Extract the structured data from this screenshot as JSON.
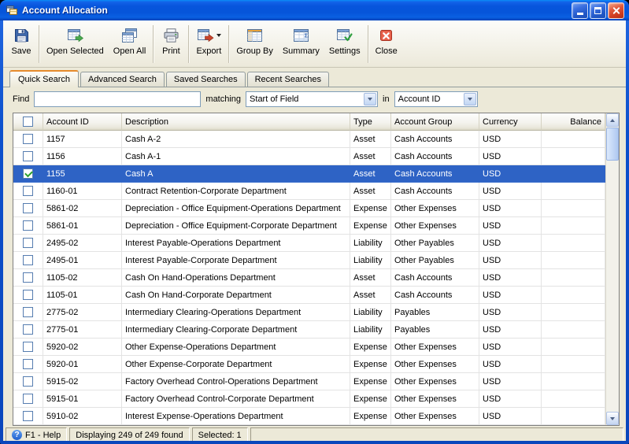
{
  "window": {
    "title": "Account Allocation"
  },
  "icons": {
    "help_glyph": "?"
  },
  "toolbar": {
    "buttons": [
      {
        "label": "Save",
        "icon": "save-icon"
      },
      {
        "label": "Open Selected",
        "icon": "open-selected-icon"
      },
      {
        "label": "Open All",
        "icon": "open-all-icon"
      },
      {
        "label": "Print",
        "icon": "print-icon"
      },
      {
        "label": "Export",
        "icon": "export-icon",
        "has_dropdown": true
      },
      {
        "label": "Group By",
        "icon": "group-by-icon"
      },
      {
        "label": "Summary",
        "icon": "summary-icon"
      },
      {
        "label": "Settings",
        "icon": "settings-icon"
      },
      {
        "label": "Close",
        "icon": "close-window-icon"
      }
    ]
  },
  "tabs": [
    {
      "label": "Quick Search",
      "active": true
    },
    {
      "label": "Advanced Search",
      "active": false
    },
    {
      "label": "Saved Searches",
      "active": false
    },
    {
      "label": "Recent Searches",
      "active": false
    }
  ],
  "search": {
    "find_label": "Find",
    "find_value": "",
    "matching_label": "matching",
    "matching_selected": "Start of Field",
    "in_label": "in",
    "in_selected": "Account ID"
  },
  "table": {
    "columns": [
      "Account ID",
      "Description",
      "Type",
      "Account Group",
      "Currency",
      "Balance"
    ],
    "rows": [
      {
        "checked": false,
        "selected": false,
        "account_id": "1157",
        "description": "Cash A-2",
        "type": "Asset",
        "account_group": "Cash Accounts",
        "currency": "USD",
        "balance": ""
      },
      {
        "checked": false,
        "selected": false,
        "account_id": "1156",
        "description": "Cash A-1",
        "type": "Asset",
        "account_group": "Cash Accounts",
        "currency": "USD",
        "balance": ""
      },
      {
        "checked": true,
        "selected": true,
        "account_id": "1155",
        "description": "Cash A",
        "type": "Asset",
        "account_group": "Cash Accounts",
        "currency": "USD",
        "balance": ""
      },
      {
        "checked": false,
        "selected": false,
        "account_id": "1160-01",
        "description": "Contract Retention-Corporate Department",
        "type": "Asset",
        "account_group": "Cash Accounts",
        "currency": "USD",
        "balance": ""
      },
      {
        "checked": false,
        "selected": false,
        "account_id": "5861-02",
        "description": "Depreciation - Office Equipment-Operations Department",
        "type": "Expense",
        "account_group": "Other Expenses",
        "currency": "USD",
        "balance": ""
      },
      {
        "checked": false,
        "selected": false,
        "account_id": "5861-01",
        "description": "Depreciation - Office Equipment-Corporate Department",
        "type": "Expense",
        "account_group": "Other Expenses",
        "currency": "USD",
        "balance": ""
      },
      {
        "checked": false,
        "selected": false,
        "account_id": "2495-02",
        "description": "Interest Payable-Operations Department",
        "type": "Liability",
        "account_group": "Other Payables",
        "currency": "USD",
        "balance": ""
      },
      {
        "checked": false,
        "selected": false,
        "account_id": "2495-01",
        "description": "Interest Payable-Corporate Department",
        "type": "Liability",
        "account_group": "Other Payables",
        "currency": "USD",
        "balance": ""
      },
      {
        "checked": false,
        "selected": false,
        "account_id": "1105-02",
        "description": "Cash On Hand-Operations Department",
        "type": "Asset",
        "account_group": "Cash Accounts",
        "currency": "USD",
        "balance": ""
      },
      {
        "checked": false,
        "selected": false,
        "account_id": "1105-01",
        "description": "Cash On Hand-Corporate Department",
        "type": "Asset",
        "account_group": "Cash Accounts",
        "currency": "USD",
        "balance": ""
      },
      {
        "checked": false,
        "selected": false,
        "account_id": "2775-02",
        "description": "Intermediary Clearing-Operations Department",
        "type": "Liability",
        "account_group": "Payables",
        "currency": "USD",
        "balance": ""
      },
      {
        "checked": false,
        "selected": false,
        "account_id": "2775-01",
        "description": "Intermediary Clearing-Corporate Department",
        "type": "Liability",
        "account_group": "Payables",
        "currency": "USD",
        "balance": ""
      },
      {
        "checked": false,
        "selected": false,
        "account_id": "5920-02",
        "description": "Other Expense-Operations Department",
        "type": "Expense",
        "account_group": "Other Expenses",
        "currency": "USD",
        "balance": ""
      },
      {
        "checked": false,
        "selected": false,
        "account_id": "5920-01",
        "description": "Other Expense-Corporate Department",
        "type": "Expense",
        "account_group": "Other Expenses",
        "currency": "USD",
        "balance": ""
      },
      {
        "checked": false,
        "selected": false,
        "account_id": "5915-02",
        "description": "Factory Overhead Control-Operations Department",
        "type": "Expense",
        "account_group": "Other Expenses",
        "currency": "USD",
        "balance": ""
      },
      {
        "checked": false,
        "selected": false,
        "account_id": "5915-01",
        "description": "Factory Overhead Control-Corporate Department",
        "type": "Expense",
        "account_group": "Other Expenses",
        "currency": "USD",
        "balance": ""
      },
      {
        "checked": false,
        "selected": false,
        "account_id": "5910-02",
        "description": "Interest Expense-Operations Department",
        "type": "Expense",
        "account_group": "Other Expenses",
        "currency": "USD",
        "balance": ""
      }
    ]
  },
  "status": {
    "help": "F1 - Help",
    "displaying": "Displaying 249 of 249 found",
    "selected": "Selected: 1"
  }
}
